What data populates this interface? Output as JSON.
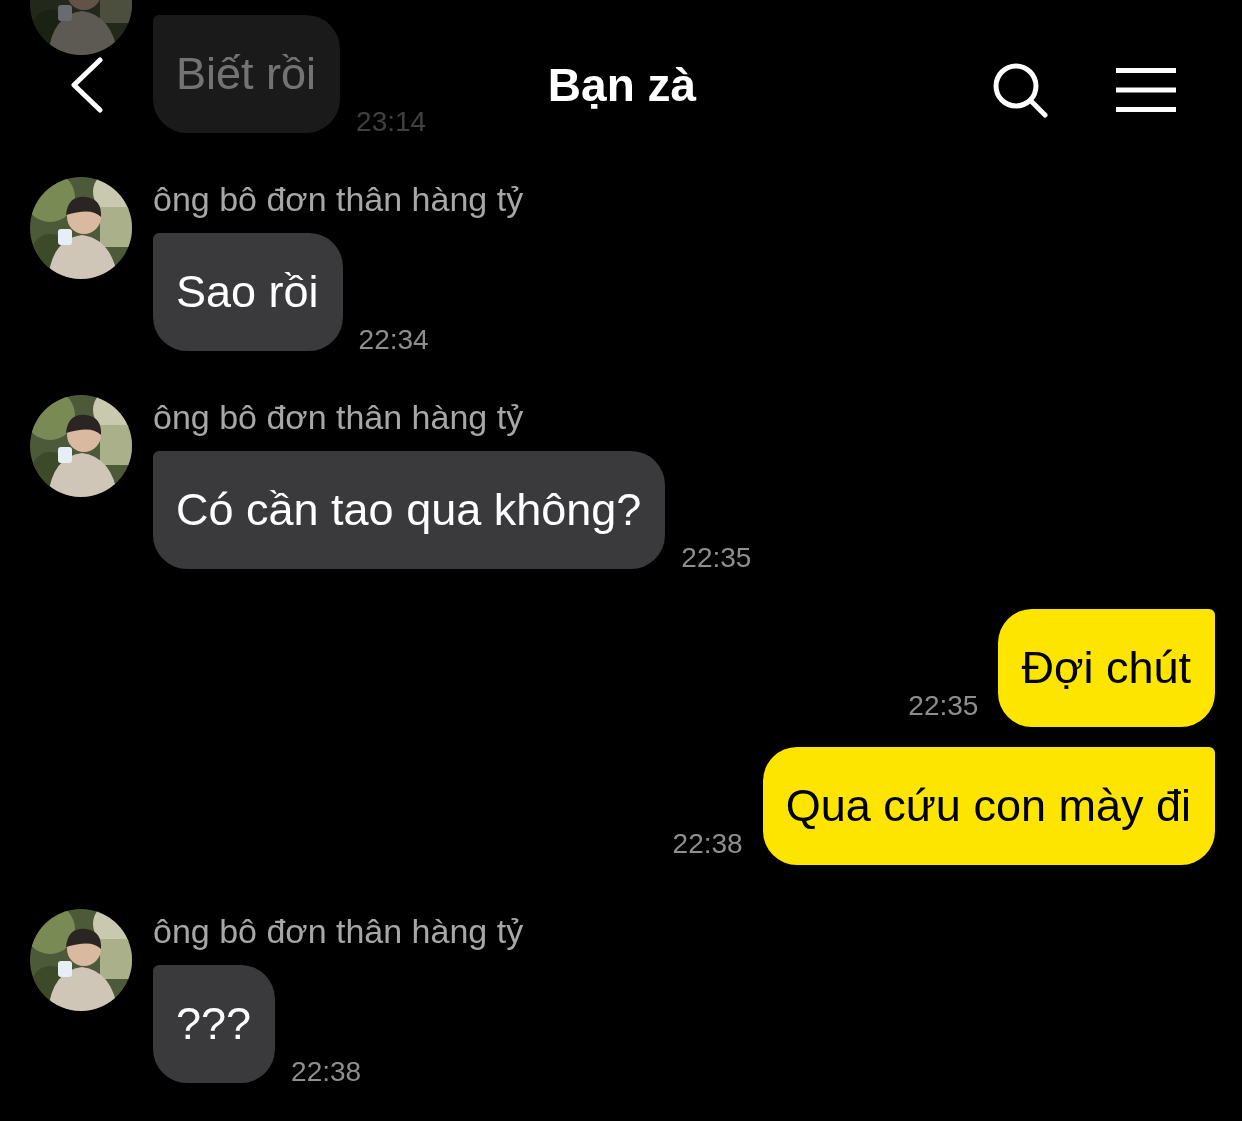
{
  "header": {
    "title": "Bạn zà"
  },
  "messages": [
    {
      "kind": "incoming",
      "faded": true,
      "text": "Biết rồi",
      "time": "23:14"
    },
    {
      "kind": "incoming",
      "faded": false,
      "sender": "ông bô đơn thân hàng tỷ",
      "text": "Sao rồi",
      "time": "22:34"
    },
    {
      "kind": "incoming",
      "faded": false,
      "sender": "ông bô đơn thân hàng tỷ",
      "text": "Có cần tao qua không?",
      "time": "22:35"
    },
    {
      "kind": "outgoing",
      "faded": false,
      "text": "Đợi chút",
      "time": "22:35"
    },
    {
      "kind": "outgoing",
      "faded": false,
      "text": "Qua cứu con mày đi",
      "time": "22:38"
    },
    {
      "kind": "incoming",
      "faded": false,
      "sender": "ông bô đơn thân hàng tỷ",
      "text": "???",
      "time": "22:38"
    }
  ]
}
